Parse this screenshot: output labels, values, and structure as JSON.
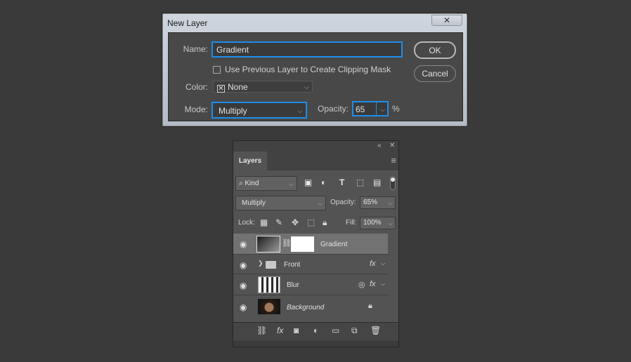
{
  "dialog": {
    "title": "New Layer",
    "close_glyph": "✕",
    "name_label": "Name:",
    "name_value": "Gradient",
    "clip_label": "Use Previous Layer to Create Clipping Mask",
    "color_label": "Color:",
    "color_value": "None",
    "mode_label": "Mode:",
    "mode_value": "Multiply",
    "opacity_label": "Opacity:",
    "opacity_value": "65",
    "percent": "%",
    "ok": "OK",
    "cancel": "Cancel"
  },
  "layers_panel": {
    "tab": "Layers",
    "kind": "Kind",
    "blend_mode": "Multiply",
    "opacity_label": "Opacity:",
    "opacity_value": "65%",
    "lock_label": "Lock:",
    "fill_label": "Fill:",
    "fill_value": "100%",
    "layers": [
      {
        "name": "Gradient",
        "selected": true
      },
      {
        "name": "Front",
        "type": "group",
        "fx": "fx"
      },
      {
        "name": "Blur",
        "fx": "fx"
      },
      {
        "name": "Background",
        "locked": true
      }
    ]
  },
  "colors": {
    "accent": "#1f8ee8"
  }
}
